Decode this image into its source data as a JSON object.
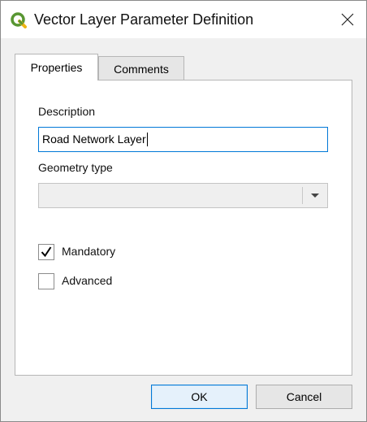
{
  "window": {
    "title": "Vector Layer Parameter Definition",
    "app_icon": "qgis-icon",
    "close_icon": "close-icon"
  },
  "tabs": [
    {
      "label": "Properties",
      "active": true
    },
    {
      "label": "Comments",
      "active": false
    }
  ],
  "form": {
    "description_label": "Description",
    "description_value": "Road Network Layer",
    "geometry_label": "Geometry type",
    "geometry_value": "",
    "mandatory_label": "Mandatory",
    "mandatory_checked": true,
    "advanced_label": "Advanced",
    "advanced_checked": false
  },
  "buttons": {
    "ok": "OK",
    "cancel": "Cancel"
  },
  "colors": {
    "accent": "#0078d7",
    "qgis_green": "#589632",
    "qgis_yellow": "#eeb413"
  }
}
